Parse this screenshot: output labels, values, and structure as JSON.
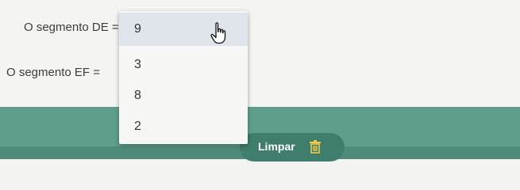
{
  "question": {
    "de_label": "O segmento DE =",
    "ef_label": "O segmento EF ="
  },
  "dropdown": {
    "options": [
      "9",
      "3",
      "8",
      "2"
    ],
    "hovered_index": 0
  },
  "footer": {
    "clear_label": "Limpar"
  },
  "icons": {
    "pointer": "hand-pointer-icon",
    "trash": "trash-icon"
  },
  "colors": {
    "footer": "#5f9e8c",
    "button": "#3f7d6c",
    "highlight": "#dfe5ea"
  }
}
